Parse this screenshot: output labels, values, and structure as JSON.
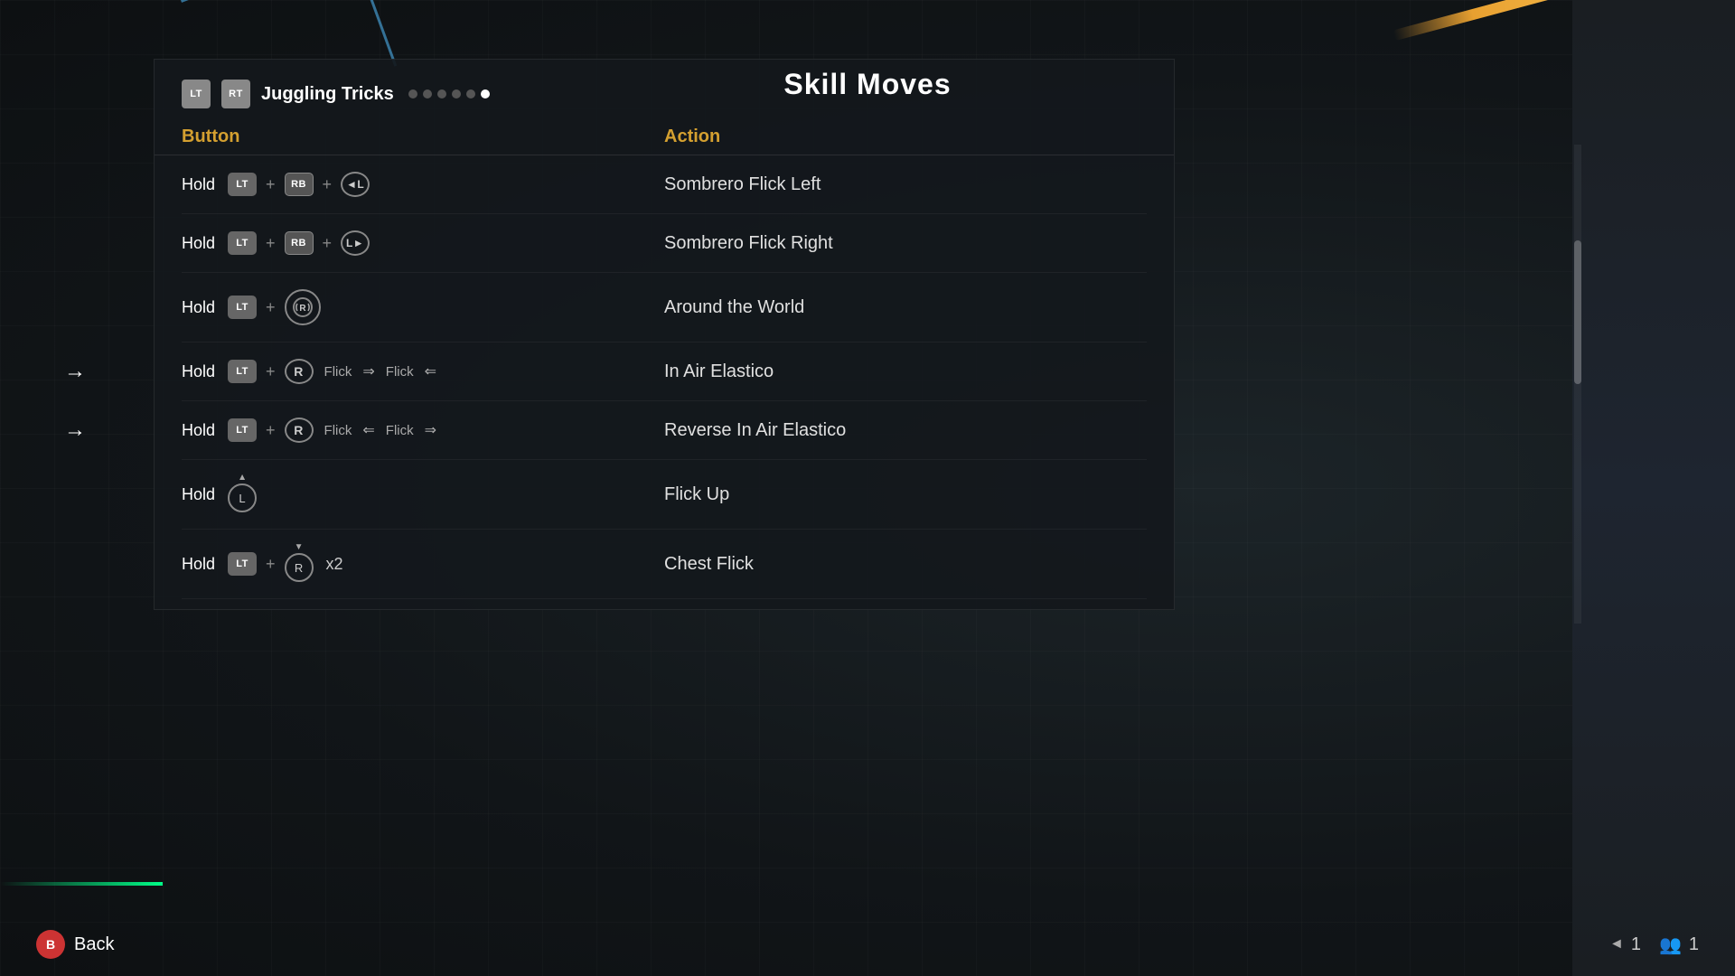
{
  "page": {
    "title": "Skill Moves",
    "background_color": "#111518"
  },
  "header": {
    "btn1": "LT",
    "btn2": "RT",
    "section_title": "Juggling Tricks",
    "dots_count": 6,
    "active_dot": 5
  },
  "columns": {
    "button_label": "Button",
    "action_label": "Action"
  },
  "moves": [
    {
      "id": 1,
      "button_desc": "Hold LT + RB + L←",
      "action": "Sombrero Flick Left",
      "has_arrow": false
    },
    {
      "id": 2,
      "button_desc": "Hold LT + RB + L→",
      "action": "Sombrero Flick Right",
      "has_arrow": false
    },
    {
      "id": 3,
      "button_desc": "Hold LT + R (spin)",
      "action": "Around the World",
      "has_arrow": false
    },
    {
      "id": 4,
      "button_desc": "Hold LT + R Flick → Flick ←",
      "action": "In Air Elastico",
      "has_arrow": true
    },
    {
      "id": 5,
      "button_desc": "Hold LT + R Flick ← Flick →",
      "action": "Reverse In Air Elastico",
      "has_arrow": true
    },
    {
      "id": 6,
      "button_desc": "Hold L (up)",
      "action": "Flick Up",
      "has_arrow": false
    },
    {
      "id": 7,
      "button_desc": "Hold LT + R (down) x2",
      "action": "Chest Flick",
      "has_arrow": false
    }
  ],
  "bottom": {
    "back_label": "Back",
    "back_btn": "B",
    "page_number": "1",
    "player_count": "1"
  }
}
